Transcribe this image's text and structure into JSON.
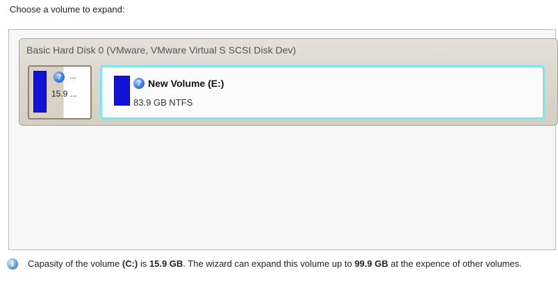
{
  "prompt": "Choose a volume to expand:",
  "disk": {
    "title": "Basic Hard Disk 0 (VMware, VMware Virtual S SCSI Disk Dev)",
    "volumes": [
      {
        "icon": "question-icon",
        "name": "...",
        "size": "15.9 ...",
        "selected": false
      },
      {
        "icon": "question-icon",
        "name": "New Volume (E:)",
        "size": "83.9 GB NTFS",
        "selected": true
      }
    ]
  },
  "info": {
    "icon": "info-icon",
    "t1": "Capasity of the volume ",
    "vol": "(C:)",
    "t2": " is ",
    "cap": "15.9 GB",
    "t3": ". The wizard can expand this volume up to ",
    "max": "99.9 GB",
    "t4": " at the expence of other volumes."
  },
  "colors": {
    "selection": "#7fe4ee",
    "bar": "#1313d8"
  }
}
